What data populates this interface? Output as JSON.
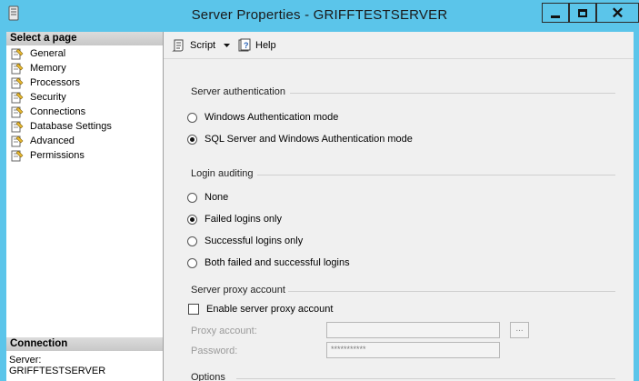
{
  "window": {
    "title": "Server Properties - GRIFFTESTSERVER"
  },
  "sidebar": {
    "header": "Select a page",
    "items": [
      {
        "label": "General"
      },
      {
        "label": "Memory"
      },
      {
        "label": "Processors"
      },
      {
        "label": "Security"
      },
      {
        "label": "Connections"
      },
      {
        "label": "Database Settings"
      },
      {
        "label": "Advanced"
      },
      {
        "label": "Permissions"
      }
    ],
    "connection": {
      "header": "Connection",
      "server_label": "Server:",
      "server_value": "GRIFFTESTSERVER"
    }
  },
  "toolbar": {
    "script_label": "Script",
    "help_label": "Help"
  },
  "server_authentication": {
    "heading": "Server authentication",
    "options": [
      {
        "label": "Windows Authentication mode",
        "selected": false
      },
      {
        "label": "SQL Server and Windows Authentication mode",
        "selected": true
      }
    ]
  },
  "login_auditing": {
    "heading": "Login auditing",
    "options": [
      {
        "label": "None",
        "selected": false
      },
      {
        "label": "Failed logins only",
        "selected": true
      },
      {
        "label": "Successful logins only",
        "selected": false
      },
      {
        "label": "Both failed and successful logins",
        "selected": false
      }
    ]
  },
  "server_proxy": {
    "heading": "Server proxy account",
    "enable_label": "Enable server proxy account",
    "enabled": false,
    "proxy_account_label": "Proxy account:",
    "proxy_account_value": "",
    "password_label": "Password:",
    "password_value": "***********",
    "browse_label": "..."
  },
  "options": {
    "heading": "Options"
  },
  "colors": {
    "title_bar": "#5bc5ea",
    "section_header": "#d4d4d4"
  }
}
